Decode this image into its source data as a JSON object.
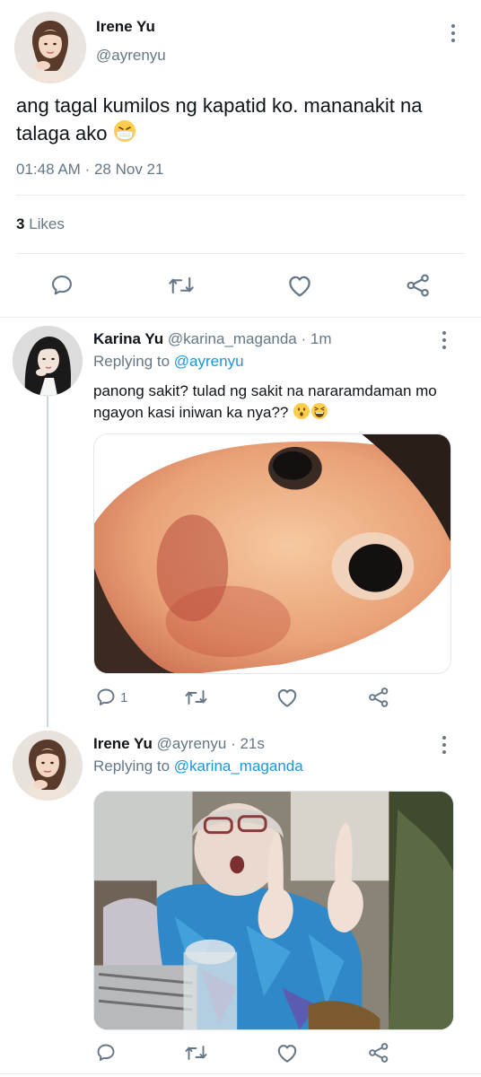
{
  "main_tweet": {
    "name": "Irene Yu",
    "handle": "@ayrenyu",
    "text": "ang tagal kumilos ng kapatid ko. mananakit na talaga ako",
    "emoji": "face-with-medical-mask-emoji",
    "time": "01:48 AM",
    "date_separator": "·",
    "date": "28 Nov 21",
    "likes_count": "3",
    "likes_label": "Likes"
  },
  "replies": [
    {
      "name": "Karina Yu",
      "handle": "@karina_maganda",
      "separator": "·",
      "time": "1m",
      "replying_label": "Replying to",
      "replying_to": "@ayrenyu",
      "text": "panong sakit? tulad ng sakit na nararamdaman mo ngayon kasi iniwan ka nya??",
      "emojis": [
        "hushed-face-emoji",
        "grinning-squinting-face-emoji"
      ],
      "reply_count": "1",
      "media": "image-upside-down-cartoon-face"
    },
    {
      "name": "Irene Yu",
      "handle": "@ayrenyu",
      "separator": "·",
      "time": "21s",
      "replying_label": "Replying to",
      "replying_to": "@karina_maganda",
      "text": "",
      "reply_count": "",
      "media": "image-old-woman-gesture"
    }
  ],
  "icons": {
    "reply": "reply-icon",
    "retweet": "retweet-icon",
    "like": "like-icon",
    "share": "share-icon",
    "more": "more-options-icon"
  },
  "colors": {
    "link": "#1b95e0",
    "secondary_text": "#657786",
    "divider": "#e6ecf0",
    "icon": "#657786"
  }
}
